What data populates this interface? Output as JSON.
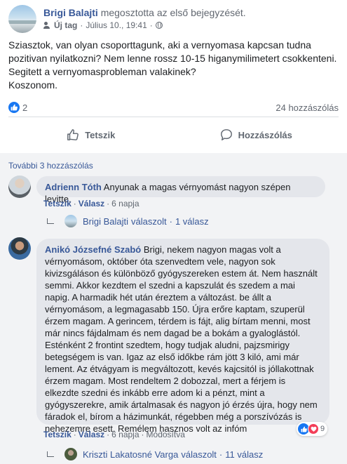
{
  "post": {
    "author": "Brigi Balajti",
    "shared_text": "megosztotta az első bejegyzését.",
    "tag_label": "Új tag",
    "date": "Július 10., 19:41",
    "body": "Sziasztok, van olyan csoporttagunk, aki a vernyomasa kapcsan tudna\npozitivan nyilatkozni? Nem lenne rossz 10-15 higanymilimetert csokkenteni.\nSegitett a vernyomasprobleman valakinek?\nKoszonom.",
    "like_count": "2",
    "comment_count": "24 hozzászólás"
  },
  "actions": {
    "like_label": "Tetszik",
    "comment_label": "Hozzászólás"
  },
  "comments": {
    "more_label": "További 3 hozzászólás",
    "items": [
      {
        "author": "Adrienn Tóth",
        "text": "Anyunak a magas vérnyomást nagyon szépen levitte.",
        "like_label": "Tetszik",
        "reply_label": "Válasz",
        "time": "6 napja",
        "reply_author": "Brigi Balajti",
        "reply_verb": "válaszolt",
        "reply_count": "1 válasz"
      },
      {
        "author": "Anikó Józsefné Szabó",
        "text": "Brigi, nekem nagyon magas volt a vérnyomásom, október óta szenvedtem vele, nagyon sok kivizsgáláson és különböző gyógyszereken estem át. Nem használt semmi. Akkor kezdtem el szedni a kapszulát és szedem a mai napig. A harmadik hét után éreztem a változást. be állt a vérnyomásom, a legmagasabb 150. Újra erőre kaptam, szuperül érzem magam. A gerincem, térdem is fájt, alig bírtam menni, most már nincs fájdalmam és nem dagad be a bokám a gyaloglástól. Esténként 2 frontint szedtem, hogy tudjak aludni, pajzsmirigy betegségem is van. Igaz az első időkbe rám jött 3 kiló, ami már lement. Az étvágyam is megváltozott, kevés kajcsitól is jóllakottnak érzem magam. Most rendeltem 2 dobozzal, mert a férjem is elkezdte szedni és inkább erre adom ki a pénzt, mint a gyógyszerekre, amik ártalmasak és nagyon jó érzés újra, hogy nem fáradok el, bírom a házimunkát, régebben még a porszívózás is nehezemre esett. Remélem hasznos volt az infóm",
        "reaction_count": "9",
        "like_label": "Tetszik",
        "reply_label": "Válasz",
        "time": "6 napja",
        "edited_label": "Módosítva",
        "reply_author": "Kriszti Lakatosné Varga",
        "reply_verb": "válaszolt",
        "reply_count": "11 válasz"
      }
    ]
  },
  "colors": {
    "link_blue": "#385898",
    "like_blue": "#1877f2",
    "heart_red": "#f33e58",
    "comment_bubble": "#e4e6eb",
    "comments_bg": "#f2f3f5"
  }
}
